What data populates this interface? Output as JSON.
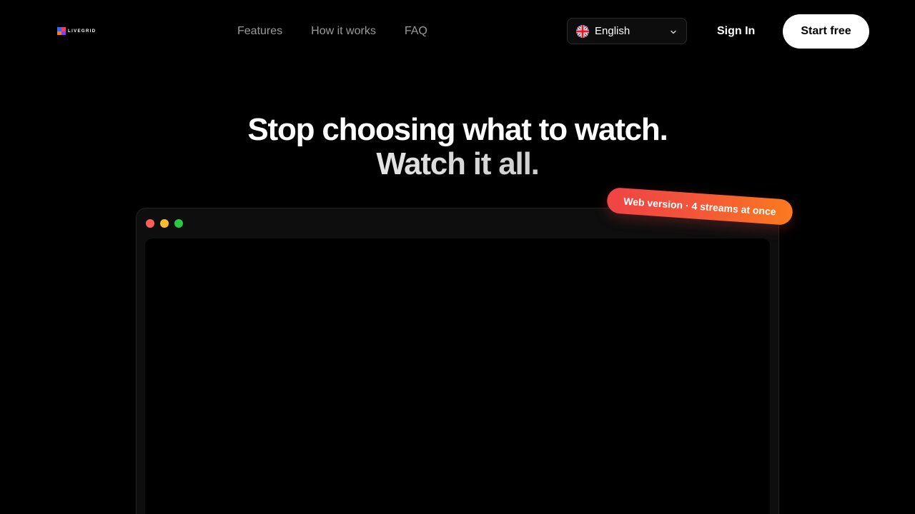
{
  "brand": {
    "logo_text": "LIVEGRID",
    "logo_colors": [
      "#2f6bff",
      "#ff3b5c",
      "#ff7a1a",
      "#8a3dff"
    ]
  },
  "nav": {
    "items": [
      {
        "label": "Features"
      },
      {
        "label": "How it works"
      },
      {
        "label": "FAQ"
      }
    ]
  },
  "language": {
    "selected": "English",
    "flag_icon": "uk-flag-icon",
    "chevron_icon": "chevron-down-icon"
  },
  "auth": {
    "signin_label": "Sign In",
    "start_label": "Start free"
  },
  "hero": {
    "line1": "Stop choosing what to watch.",
    "line2": "Watch it all."
  },
  "browser_mock": {
    "dot_colors": [
      "#ff5f57",
      "#febc2e",
      "#28c840"
    ]
  },
  "badge": {
    "text": "Web version · 4 streams at once",
    "gradient": [
      "#ef4444",
      "#fb7a1e"
    ]
  },
  "colors": {
    "background": "#000000",
    "accent_orange": "#fb7a1e",
    "accent_red": "#ef4444"
  }
}
